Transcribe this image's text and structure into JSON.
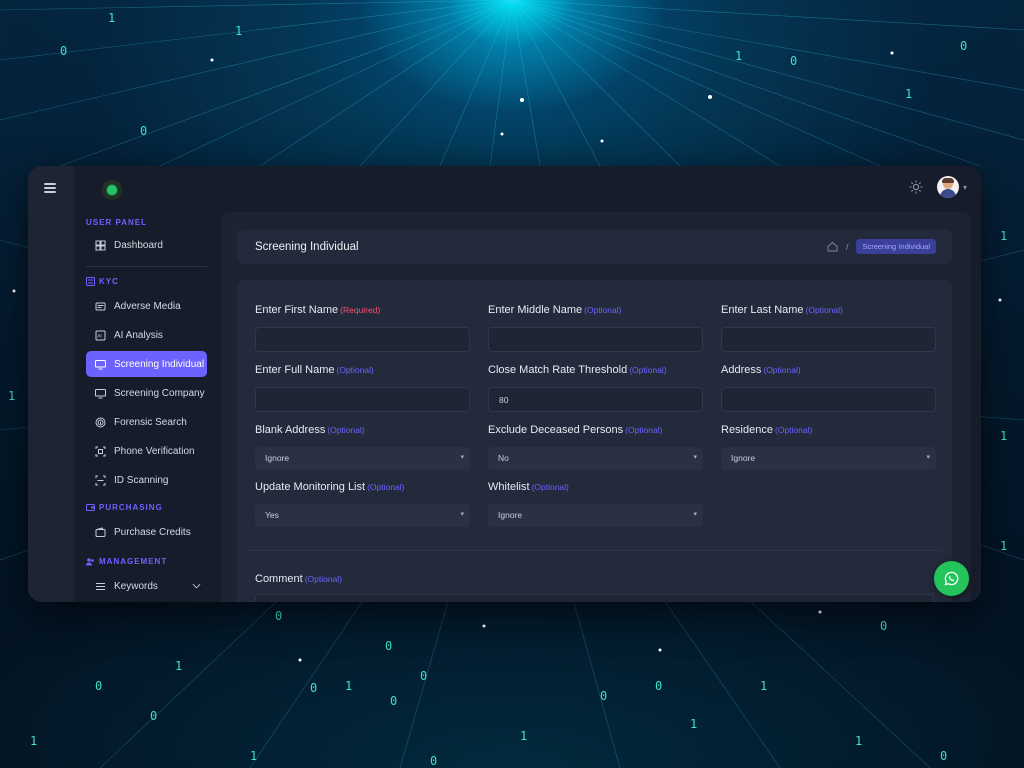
{
  "colors": {
    "accent": "#6c63ff",
    "required": "#ff4d6d",
    "panel": "#232a3b",
    "background": "#171c2b",
    "whatsapp": "#25c45a"
  },
  "sidebar": {
    "user_panel_label": "USER PANEL",
    "dashboard": "Dashboard",
    "kyc_label": "KYC",
    "kyc_items": [
      {
        "label": "Adverse Media",
        "icon": "newspaper-icon"
      },
      {
        "label": "AI Analysis",
        "icon": "ai-icon"
      },
      {
        "label": "Screening Individual",
        "icon": "monitor-icon",
        "active": true
      },
      {
        "label": "Screening Company",
        "icon": "monitor-icon"
      },
      {
        "label": "Forensic Search",
        "icon": "fingerprint-icon"
      },
      {
        "label": "Phone Verification",
        "icon": "qr-scan-icon"
      },
      {
        "label": "ID Scanning",
        "icon": "scan-icon"
      }
    ],
    "purchasing_label": "PURCHASING",
    "purchase_credits": "Purchase Credits",
    "management_label": "MANAGEMENT",
    "keywords": "Keywords"
  },
  "header": {
    "title": "Screening Individual",
    "breadcrumb_separator": "/",
    "breadcrumb_current": "Screening Individual"
  },
  "form": {
    "first_name": {
      "label": "Enter First Name",
      "tag": "(Required)",
      "value": ""
    },
    "middle_name": {
      "label": "Enter Middle Name",
      "tag": "(Optional)",
      "value": ""
    },
    "last_name": {
      "label": "Enter Last Name",
      "tag": "(Optional)",
      "value": ""
    },
    "full_name": {
      "label": "Enter Full Name",
      "tag": "(Optional)",
      "value": ""
    },
    "threshold": {
      "label": "Close Match Rate Threshold",
      "tag": "(Optional)",
      "value": "80"
    },
    "address": {
      "label": "Address",
      "tag": "(Optional)",
      "value": ""
    },
    "blank_address": {
      "label": "Blank Address",
      "tag": "(Optional)",
      "value": "Ignore"
    },
    "exclude_deceased": {
      "label": "Exclude Deceased Persons",
      "tag": "(Optional)",
      "value": "No"
    },
    "residence": {
      "label": "Residence",
      "tag": "(Optional)",
      "value": "Ignore"
    },
    "update_monitoring": {
      "label": "Update Monitoring List",
      "tag": "(Optional)",
      "value": "Yes"
    },
    "whitelist": {
      "label": "Whitelist",
      "tag": "(Optional)",
      "value": "Ignore"
    },
    "comment": {
      "label": "Comment",
      "tag": "(Optional)",
      "value": ""
    }
  },
  "select_arrow": "▾",
  "caret": "▾"
}
